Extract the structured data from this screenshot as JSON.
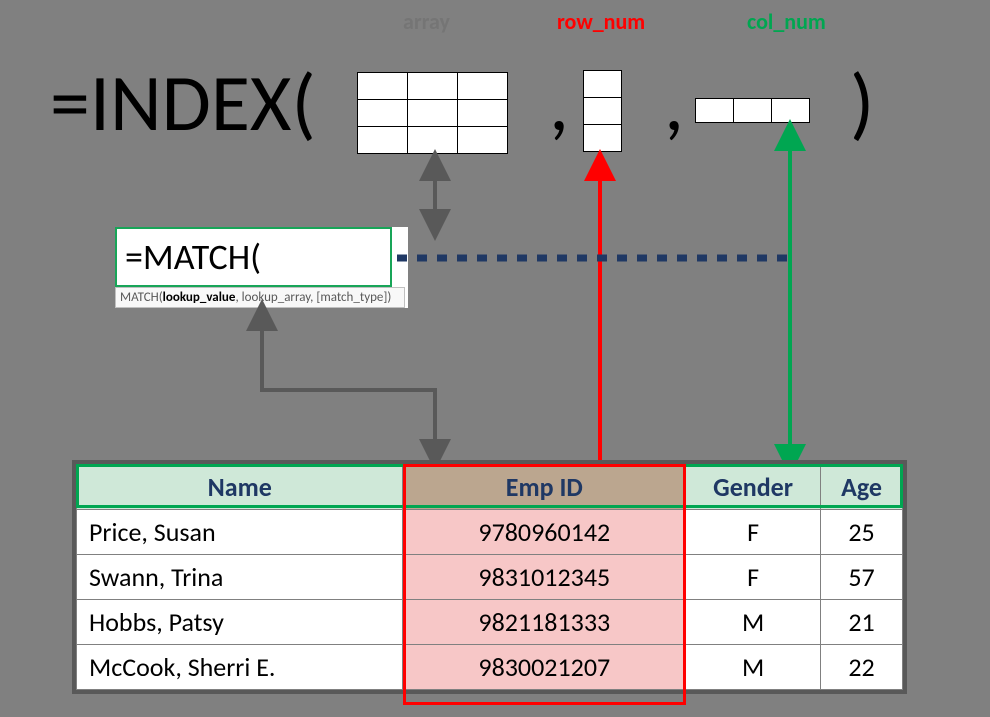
{
  "labels": {
    "array": "array",
    "row_num": "row_num",
    "col_num": "col_num"
  },
  "formula": {
    "index_prefix": "=INDEX(",
    "comma": ",",
    "close": ")",
    "match_text": "=MATCH(",
    "match_tooltip_fn": "MATCH(",
    "match_tooltip_arg1": "lookup_value",
    "match_tooltip_rest": ", lookup_array, [match_type])"
  },
  "table": {
    "headers": [
      "Name",
      "Emp ID",
      "Gender",
      "Age"
    ],
    "rows": [
      {
        "name": "Price, Susan",
        "empid": "9780960142",
        "gender": "F",
        "age": "25"
      },
      {
        "name": "Swann, Trina",
        "empid": "9831012345",
        "gender": "F",
        "age": "57"
      },
      {
        "name": "Hobbs, Patsy",
        "empid": "9821181333",
        "gender": "M",
        "age": "21"
      },
      {
        "name": "McCook, Sherri E.",
        "empid": "9830021207",
        "gender": "M",
        "age": "22"
      }
    ]
  }
}
